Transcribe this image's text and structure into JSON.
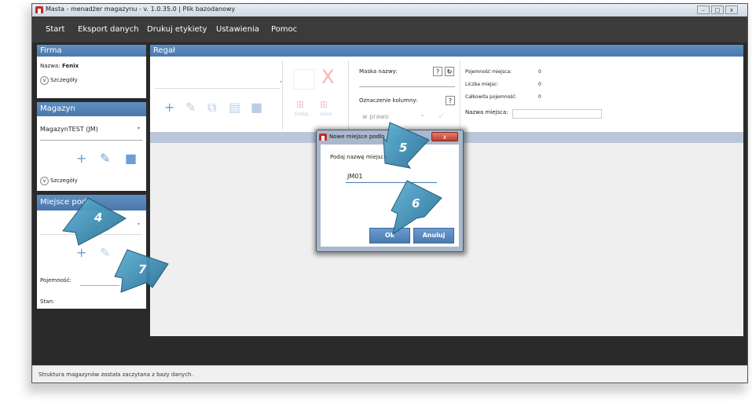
{
  "window": {
    "title": "Masta - menadżer magazynu - v. 1.0.35.0 | Plik bazodanowy"
  },
  "menu": [
    "Start",
    "Eksport danych",
    "Drukuj etykiety",
    "Ustawienia",
    "Pomoc"
  ],
  "firma": {
    "header": "Firma",
    "name_label": "Nazwa:",
    "name_value": "Fenix",
    "details": "Szczegóły"
  },
  "magazyn": {
    "header": "Magazyn",
    "selected": "MagazynTEST (JM)",
    "details": "Szczegóły"
  },
  "miejsce": {
    "header": "Miejsce podł",
    "capacity_label": "Pojemność:",
    "state_label": "Stan:"
  },
  "regal": {
    "header": "Regał",
    "add_label": "Dodaj",
    "remove_label": "Usuń",
    "mask_label": "Maska nazwy:",
    "column_label": "Oznaczenie kolumny:",
    "direction_value": "w prawo",
    "help": "?",
    "place_capacity_label": "Pojemność miejsca:",
    "place_capacity_value": "0",
    "places_count_label": "Liczba miejsc:",
    "places_count_value": "0",
    "total_capacity_label": "Całkowita pojemność:",
    "total_capacity_value": "0",
    "place_name_label": "Nazwa miejsca:"
  },
  "dialog": {
    "title": "Nowe miejsce podło",
    "prompt": "Podaj nazwę miejsca",
    "input_value": "JM01",
    "ok": "Ok",
    "cancel": "Anuluj",
    "close": "x"
  },
  "callouts": [
    "4",
    "5",
    "6",
    "7"
  ],
  "status": "Struktura magazynów została zaczytana z bazy danych.",
  "colors": {
    "accent": "#4a78ab",
    "callout": "#3f8fb4",
    "menubar": "#3b3b3b"
  }
}
